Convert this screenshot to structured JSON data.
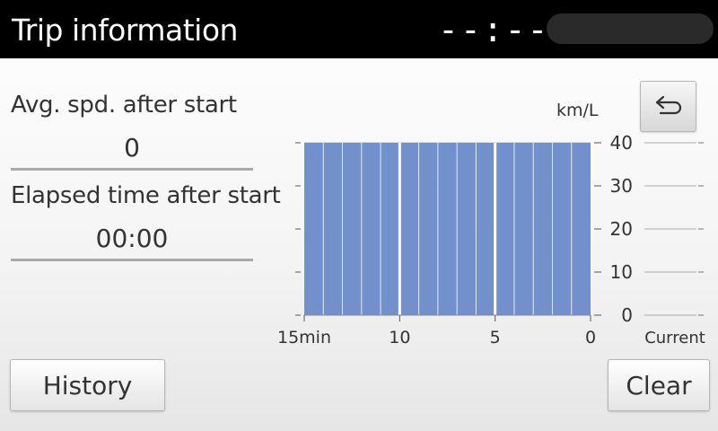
{
  "header": {
    "title": "Trip information",
    "clock": "--:--"
  },
  "stats": {
    "avg_speed_label": "Avg. spd. after start",
    "avg_speed_value": "0",
    "elapsed_label": "Elapsed time after start",
    "elapsed_value": "00:00"
  },
  "chart_data": {
    "type": "bar",
    "title": "",
    "ylabel": "km/L",
    "xlabel": "",
    "ylim": [
      0,
      40
    ],
    "yticks": [
      "0",
      "10",
      "20",
      "30",
      "40"
    ],
    "xticks": [
      "15min",
      "10",
      "5",
      "0"
    ],
    "values": [
      40,
      40,
      40,
      40,
      40,
      40,
      40,
      40,
      40,
      40,
      40,
      40,
      40,
      40,
      40
    ],
    "bar_color": "#7190cc",
    "current_label": "Current",
    "current_value": null
  },
  "buttons": {
    "back_icon": "return-arrow-icon",
    "history": "History",
    "clear": "Clear"
  }
}
